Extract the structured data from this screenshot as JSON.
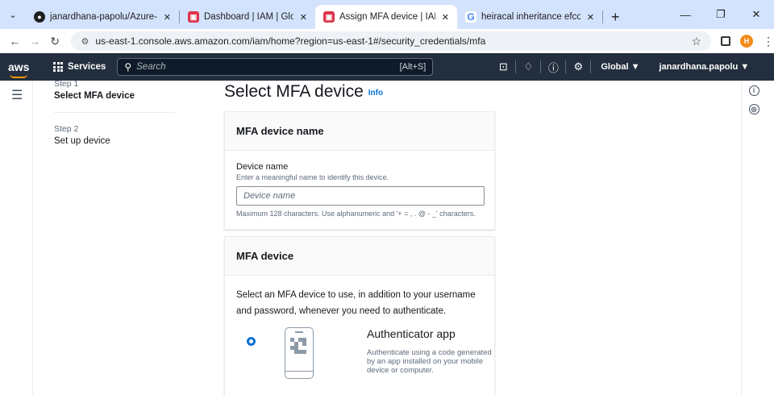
{
  "browser": {
    "tabs": [
      {
        "title": "janardhana-papolu/Azure-Aws",
        "favicon": "github-icon",
        "active": false
      },
      {
        "title": "Dashboard | IAM | Global",
        "favicon": "aws-iam-icon",
        "active": false
      },
      {
        "title": "Assign MFA device | IAM | Glob",
        "favicon": "aws-iam-icon",
        "active": true
      },
      {
        "title": "heiracal inheritance efcore don",
        "favicon": "google-icon",
        "active": false
      }
    ],
    "url": "us-east-1.console.aws.amazon.com/iam/home?region=us-east-1#/security_credentials/mfa",
    "profile_initial": "H"
  },
  "aws_header": {
    "logo": "aws",
    "services_label": "Services",
    "search_placeholder": "Search",
    "search_shortcut": "[Alt+S]",
    "region": "Global ▼",
    "account": "janardhana.papolu ▼"
  },
  "wizard": {
    "steps": [
      {
        "label": "Step 1",
        "title": "Select MFA device"
      },
      {
        "label": "Step 2",
        "title": "Set up device"
      }
    ]
  },
  "page": {
    "title": "Select MFA device",
    "info_link": "Info"
  },
  "device_name_panel": {
    "heading": "MFA device name",
    "field_label": "Device name",
    "field_description": "Enter a meaningful name to identify this device.",
    "field_placeholder": "Device name",
    "field_value": "",
    "constraint": "Maximum 128 characters. Use alphanumeric and '+ = , . @ - _' characters."
  },
  "mfa_device_panel": {
    "heading": "MFA device",
    "description": "Select an MFA device to use, in addition to your username and password, whenever you need to authenticate.",
    "options": [
      {
        "title": "Authenticator app",
        "description": "Authenticate using a code generated by an app installed on your mobile device or computer.",
        "selected": true,
        "icon": "authenticator-phone-icon"
      }
    ]
  },
  "colors": {
    "aws_header_bg": "#232f3e",
    "accent_blue": "#0972d3",
    "tab_strip_bg": "#d3e3fd"
  }
}
